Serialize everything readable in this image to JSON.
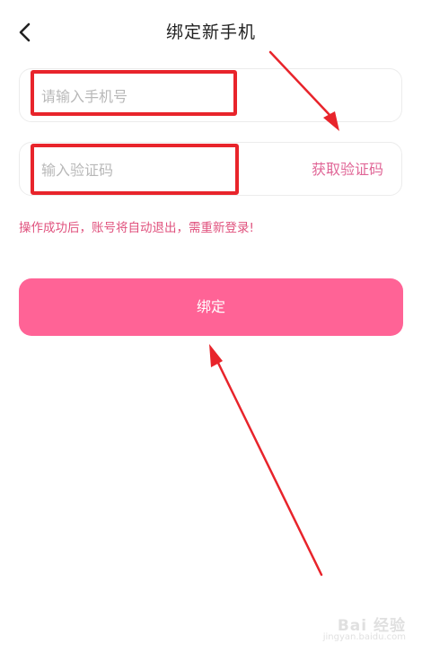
{
  "header": {
    "title": "绑定新手机",
    "back_icon": "chevron-left-icon"
  },
  "form": {
    "phone_placeholder": "请输入手机号",
    "code_placeholder": "输入验证码",
    "get_code_label": "获取验证码"
  },
  "notice": "操作成功后，账号将自动退出，需重新登录!",
  "bind_button_label": "绑定",
  "watermark": {
    "main": "Bai 经验",
    "sub": "jingyan.baidu.com"
  },
  "colors": {
    "accent": "#ff6396",
    "notice": "#e0527e",
    "annotation": "#e8242b"
  }
}
